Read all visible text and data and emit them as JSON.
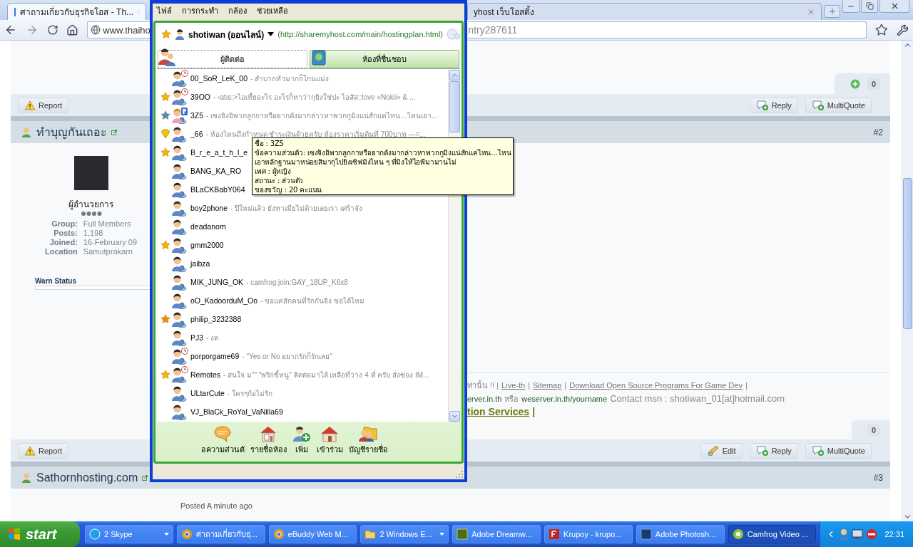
{
  "browser": {
    "tabs": [
      {
        "title": "ศาถามเกี่ยวกับธุรกิจโฮส - Th...",
        "selected": true
      },
      {
        "title": "yhost เว็บโฮสติ้ง",
        "selected": false
      }
    ],
    "address": {
      "start": "www.thaiho",
      "end": "ntry287611"
    }
  },
  "forum": {
    "post1_footer": {
      "count": "0",
      "report": "Report",
      "buttons": [
        {
          "kind": "reply",
          "label": "Reply"
        },
        {
          "kind": "reply",
          "label": "MultiQuote"
        }
      ]
    },
    "post2": {
      "author": "ทำบุญกันเถอะ",
      "number": "#2",
      "rank": "ผู้อำนวยการ",
      "fields": [
        {
          "label": "Group:",
          "value": "Full Members"
        },
        {
          "label": "Posts:",
          "value": "1,198"
        },
        {
          "label": "Joined:",
          "value": "16-February 09"
        },
        {
          "label": "Location",
          "value": "Samutprakarn"
        }
      ],
      "warn_label": "Warn Status",
      "signature": [
        [
          {
            "kind": "plain",
            "text": "ท่านั้น !! |"
          },
          {
            "kind": "link",
            "text": "Live-th"
          },
          {
            "kind": "plain",
            "text": "|"
          },
          {
            "kind": "link",
            "text": "Sitemap"
          },
          {
            "kind": "plain",
            "text": "|"
          },
          {
            "kind": "link",
            "text": "Download Open Source Programs For Game Dev"
          },
          {
            "kind": "plain",
            "text": "|"
          }
        ],
        [
          {
            "kind": "domain",
            "text": "erver.in.th"
          },
          {
            "kind": "plain",
            "text": "หรือ"
          },
          {
            "kind": "domain",
            "text": "weserver.in.th/yourname"
          },
          {
            "kind": "contact",
            "text": "Contact msn : shotiwan_01[at]hotmail.com"
          }
        ],
        [
          {
            "kind": "banner",
            "text": "tion Services"
          },
          {
            "kind": "banner",
            "text": "|"
          }
        ]
      ],
      "count": "0",
      "report": "Report",
      "buttons": [
        {
          "kind": "edit",
          "label": "Edit"
        },
        {
          "kind": "reply",
          "label": "Reply"
        },
        {
          "kind": "reply",
          "label": "MultiQuote"
        }
      ]
    },
    "post3": {
      "author": "Sathornhosting.com",
      "number": "#3",
      "posted": "Posted A minute ago"
    }
  },
  "camfrog": {
    "menu": [
      "ไฟล์",
      "การกระทำ",
      "กล้อง",
      "ช่วยเหลือ"
    ],
    "user": "shotiwan (ออนไลน์)",
    "user_link": "(http://sharemyhost.com/main/hostingplan.html)",
    "tabs": [
      {
        "label": "ผู้ติดต่อ",
        "selected": true
      },
      {
        "label": "ห้องที่ชื่นชอบ",
        "selected": false
      }
    ],
    "contacts": [
      {
        "name": "00_SoR_LeK_00",
        "message": "- สำบากหัวมากก็โกนแม่ง",
        "kind": "away"
      },
      {
        "name": "39OO",
        "message": "- ‹atıs:>ไอเหี้ยอะไร อะไรก็หาว่ากุยิงใช่ปะ ไอสัส::love «Nokii» & ...",
        "kind": "away",
        "badge": {
          "kind": "star",
          "color": "#f7b500"
        }
      },
      {
        "name": "3Z5",
        "message": "- เซงจิงอิพวกลูกกาหรือยากดังมากล่าวหาพวกกูมิงแน่สักแค่ไหน…ไหนเอา...",
        "kind": "private",
        "badge": {
          "kind": "star",
          "color": "#3d8de0"
        }
      },
      {
        "name": "_66",
        "message": "- ห้องไหนถึงกำหนด ชำระเงินด้วยครับ  ห้องราคาเริ่มต้นที่ 700บาท  —=...",
        "kind": "online",
        "badge": {
          "kind": "diamond"
        }
      },
      {
        "name": "B_r_e_a_t_h_l_e",
        "kind": "online",
        "badge": {
          "kind": "star",
          "color": "#f7b500"
        }
      },
      {
        "name": "BANG_KA_RO",
        "kind": "online"
      },
      {
        "name": "BLaCKBabY064",
        "kind": "online"
      },
      {
        "name": "boy2phone",
        "message": "- ปีใหม่แล้ว ยังหาเมียไม่ด้ายเลยเรา เศร้าจัง",
        "kind": "online"
      },
      {
        "name": "deadanom",
        "kind": "online"
      },
      {
        "name": "gmm2000",
        "kind": "online",
        "badge": {
          "kind": "star",
          "color": "#f7b500"
        }
      },
      {
        "name": "jaibza",
        "kind": "online"
      },
      {
        "name": "MIK_JUNG_OK",
        "message": "- camfrog:join:GAY_18UP_K6x8",
        "kind": "online"
      },
      {
        "name": "oO_KadoorduM_Oo",
        "message": "- ขอแค่สักคนที่รักกันจิง ขอได้ไหม",
        "kind": "online"
      },
      {
        "name": "philip_3232388",
        "kind": "online",
        "badge": {
          "kind": "star",
          "color": "#f08a00"
        }
      },
      {
        "name": "PJ3",
        "message": "- งด",
        "kind": "online"
      },
      {
        "name": "porporgame69",
        "message": "- \"Yes or No อยากรักก็รักเลย\"",
        "kind": "away"
      },
      {
        "name": "Remotes",
        "message": "- สนใจ ม\"\" \"พริกขี้หนู\" ติดต่อมาได้ เหลือที่ว่าง 4 ที่ ครับ  สั่งซ่อง IM...",
        "kind": "away",
        "badge": {
          "kind": "star",
          "color": "#f7b500"
        }
      },
      {
        "name": "ULtarCute",
        "message": "- ใครๆก้อไม่รัก",
        "kind": "online"
      },
      {
        "name": "VJ_BlaCk_RoYal_VaNilla69",
        "kind": "online"
      }
    ],
    "toolbar": [
      {
        "kind": "message",
        "label": "อความส่วนตั"
      },
      {
        "kind": "rooms",
        "label": "รายชื่อห้อง"
      },
      {
        "kind": "add",
        "label": "เพิ่ม"
      },
      {
        "kind": "join",
        "label": "เข้าร่วม"
      },
      {
        "kind": "list",
        "label": "บัญชีรายชื่อ"
      }
    ]
  },
  "tooltip": {
    "lines": [
      "ชื่อ : 3Z5",
      "ข้อความส่วนตัว: เซงจิงอิพวกลูกกาหรือยากดังมากล่าวหาพวกกูมิงแน่สักแค่ไหน…ไหน",
      "เอาหลักฐานมาหน่อยสิมากุไปยิงเซิฟมิงไหน ๆ ที่มิงให้ไอพีมามานไม่",
      "เพศ : ผู้หญิง",
      "สถานะ : ส่วนตัว",
      "ของขวัญ : 20 คะแนน"
    ]
  },
  "taskbar": {
    "start": "start",
    "items": [
      {
        "kind": "skype",
        "label": "2 Skype",
        "menu": true,
        "selected": false
      },
      {
        "kind": "browser",
        "label": "ศาถามเกี่ยวกับธุ...",
        "menu": false,
        "selected": false
      },
      {
        "kind": "browser",
        "label": "eBuddy Web M...",
        "menu": false,
        "selected": false
      },
      {
        "kind": "folder",
        "label": "2 Windows E...",
        "menu": true,
        "selected": false
      },
      {
        "kind": "dreamweaver",
        "label": "Adobe Dreamw...",
        "menu": false,
        "selected": false
      },
      {
        "kind": "ftp",
        "label": "Krupoy - krupo...",
        "menu": false,
        "selected": false
      },
      {
        "kind": "photoshop",
        "label": "Adobe Photosh...",
        "menu": false,
        "selected": false
      },
      {
        "kind": "camfrog",
        "label": "Camfrog Video ...",
        "menu": false,
        "selected": true
      }
    ],
    "clock": "22:31"
  }
}
